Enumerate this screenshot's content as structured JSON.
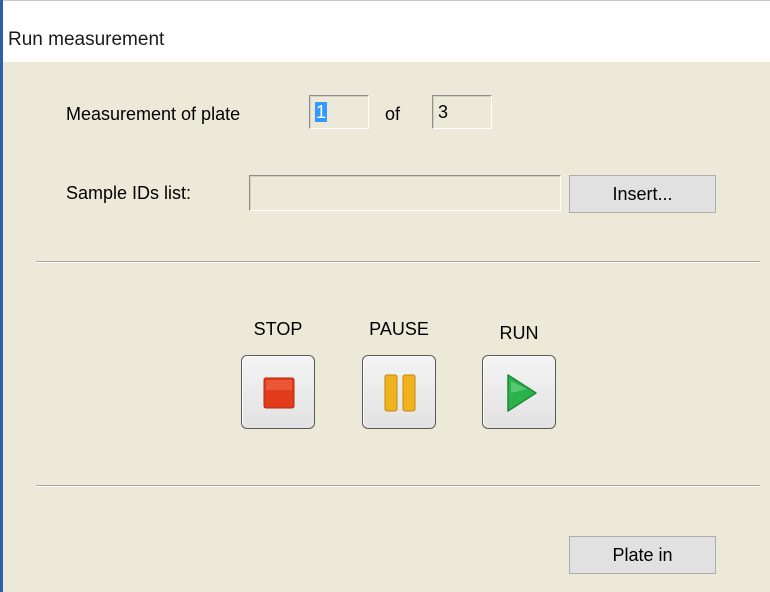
{
  "window": {
    "title": "Run measurement"
  },
  "plate": {
    "label": "Measurement of plate",
    "current": "1",
    "of_label": "of",
    "total": "3"
  },
  "samples": {
    "label": "Sample IDs list:",
    "value": "",
    "insert_button": "Insert..."
  },
  "controls": {
    "stop_label": "STOP",
    "pause_label": "PAUSE",
    "run_label": "RUN",
    "stop_icon": "stop-icon",
    "pause_icon": "pause-icon",
    "run_icon": "play-icon",
    "stop_color": "#e23b1c",
    "pause_color": "#f0b21e",
    "run_color": "#2bb24c"
  },
  "footer": {
    "plate_in_button": "Plate in"
  }
}
